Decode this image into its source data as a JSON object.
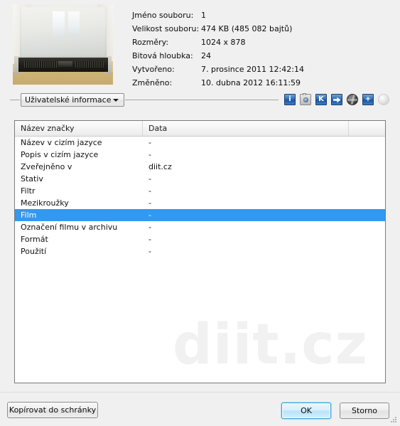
{
  "file_info": {
    "rows": [
      {
        "label": "Jméno souboru:",
        "value": "1"
      },
      {
        "label": "Velikost souboru:",
        "value": "474 KB (485 082 bajtů)"
      },
      {
        "label": "Rozměry:",
        "value": "1024 x 878"
      },
      {
        "label": "Bitová hloubka:",
        "value": "24"
      },
      {
        "label": "Vytvořeno:",
        "value": "7. prosince 2011 12:42:14"
      },
      {
        "label": "Změněno:",
        "value": "10. dubna 2012 16:11:59"
      }
    ]
  },
  "thumbnail": {
    "alt": "server-photo-thumbnail"
  },
  "category_combo": {
    "selected": "Uživatelské informace",
    "arrow_icon": "chevron-down-icon"
  },
  "toolbar": {
    "buttons": [
      {
        "name": "info-icon",
        "glyph": "i",
        "style": "blue",
        "enabled": true
      },
      {
        "name": "camera-icon",
        "glyph": "",
        "style": "camera",
        "enabled": true
      },
      {
        "name": "keywords-icon",
        "glyph": "K",
        "style": "blue",
        "enabled": true
      },
      {
        "name": "arrow-right-icon",
        "glyph": "",
        "style": "arrow",
        "enabled": true
      },
      {
        "name": "globe-icon",
        "glyph": "",
        "style": "globe",
        "enabled": true
      },
      {
        "name": "plus-icon",
        "glyph": "+",
        "style": "blue",
        "enabled": true
      },
      {
        "name": "sphere-icon",
        "glyph": "",
        "style": "disabled",
        "enabled": false
      }
    ]
  },
  "list": {
    "columns": [
      "Název značky",
      "Data",
      ""
    ],
    "selected_index": 6,
    "rows": [
      {
        "name": "Název v cizím jazyce",
        "data": "-"
      },
      {
        "name": "Popis v cizím jazyce",
        "data": "-"
      },
      {
        "name": "Zveřejněno v",
        "data": "diit.cz"
      },
      {
        "name": "Stativ",
        "data": "-"
      },
      {
        "name": "Filtr",
        "data": "-"
      },
      {
        "name": "Mezikroužky",
        "data": "-"
      },
      {
        "name": "Film",
        "data": "-"
      },
      {
        "name": "Označení filmu v archivu",
        "data": "-"
      },
      {
        "name": "Formát",
        "data": "-"
      },
      {
        "name": "Použití",
        "data": "-"
      }
    ],
    "watermark": "diit.cz",
    "selection_color": "#3399f0"
  },
  "buttons": {
    "copy": "Kopírovat do schránky",
    "ok": "OK",
    "cancel": "Storno"
  }
}
